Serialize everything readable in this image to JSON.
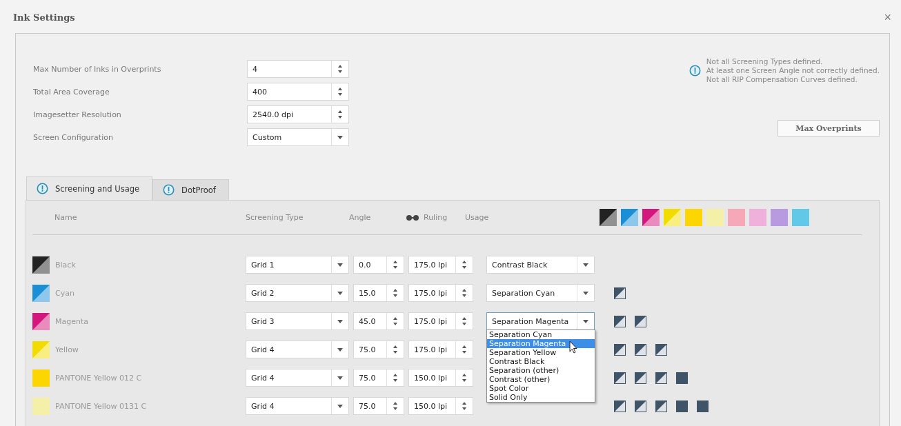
{
  "window": {
    "title": "Ink Settings",
    "close": "×"
  },
  "settings": [
    {
      "label": "Max Number of Inks in Overprints",
      "kind": "spin",
      "value": "4"
    },
    {
      "label": "Total Area Coverage",
      "kind": "spin",
      "value": "400"
    },
    {
      "label": "Imagesetter Resolution",
      "kind": "spin",
      "value": "2540.0 dpi"
    },
    {
      "label": "Screen Configuration",
      "kind": "select",
      "value": "Custom"
    }
  ],
  "warnings": [
    "Not all Screening Types defined.",
    "At least one Screen Angle not correctly defined.",
    "Not all RIP Compensation Curves defined."
  ],
  "max_overprints_button": "Max Overprints",
  "tabs": [
    {
      "label": "Screening and Usage",
      "selected": true,
      "warning": true
    },
    {
      "label": "DotProof",
      "selected": false,
      "warning": true
    }
  ],
  "columns": {
    "name": "Name",
    "screening_type": "Screening Type",
    "angle": "Angle",
    "ruling": "Ruling",
    "usage": "Usage"
  },
  "header_swatches": [
    {
      "kind": "split",
      "color": "#222222"
    },
    {
      "kind": "split",
      "color": "#1b8fd6"
    },
    {
      "kind": "split",
      "color": "#d4177c"
    },
    {
      "kind": "split",
      "color": "#f2dc00"
    },
    {
      "kind": "solid",
      "color": "#fdd500"
    },
    {
      "kind": "solid",
      "color": "#f5f0a8"
    },
    {
      "kind": "solid",
      "color": "#f7a8b8"
    },
    {
      "kind": "solid",
      "color": "#f0b0dc"
    },
    {
      "kind": "solid",
      "color": "#b89ae0"
    },
    {
      "kind": "solid",
      "color": "#62c8e8"
    }
  ],
  "inks": [
    {
      "name": "Black",
      "swatch": {
        "kind": "split",
        "color": "#222222"
      },
      "screening_type": "Grid 1",
      "angle": "0.0",
      "ruling": "175.0 lpi",
      "usage": "Contrast Black",
      "usage_open": false
    },
    {
      "name": "Cyan",
      "swatch": {
        "kind": "split",
        "color": "#1b8fd6"
      },
      "screening_type": "Grid 2",
      "angle": "15.0",
      "ruling": "175.0 lpi",
      "usage": "Separation Cyan",
      "usage_open": false,
      "overprints": [
        {
          "kind": "split"
        }
      ]
    },
    {
      "name": "Magenta",
      "swatch": {
        "kind": "split",
        "color": "#d4177c"
      },
      "screening_type": "Grid 3",
      "angle": "45.0",
      "ruling": "175.0 lpi",
      "usage": "Separation Magenta",
      "usage_open": true,
      "overprints": [
        {
          "kind": "split"
        },
        {
          "kind": "split"
        }
      ]
    },
    {
      "name": "Yellow",
      "swatch": {
        "kind": "split",
        "color": "#f2dc00"
      },
      "screening_type": "Grid 4",
      "angle": "75.0",
      "ruling": "175.0 lpi",
      "overprints": [
        {
          "kind": "split"
        },
        {
          "kind": "split"
        },
        {
          "kind": "split"
        }
      ]
    },
    {
      "name": "PANTONE Yellow 012 C",
      "swatch": {
        "kind": "solid",
        "color": "#fdd500"
      },
      "screening_type": "Grid 4",
      "angle": "75.0",
      "ruling": "150.0 lpi",
      "overprints": [
        {
          "kind": "split"
        },
        {
          "kind": "split"
        },
        {
          "kind": "split"
        },
        {
          "kind": "solid"
        }
      ]
    },
    {
      "name": "PANTONE Yellow 0131 C",
      "swatch": {
        "kind": "solid",
        "color": "#f5f0a8"
      },
      "screening_type": "Grid 4",
      "angle": "75.0",
      "ruling": "150.0 lpi",
      "overprints": [
        {
          "kind": "split"
        },
        {
          "kind": "split"
        },
        {
          "kind": "split"
        },
        {
          "kind": "solid"
        },
        {
          "kind": "solid"
        }
      ]
    }
  ],
  "usage_menu": [
    {
      "label": "Separation Cyan",
      "selected": false
    },
    {
      "label": "Separation Magenta",
      "selected": true
    },
    {
      "label": "Separation Yellow",
      "selected": false
    },
    {
      "label": "Contrast Black",
      "selected": false
    },
    {
      "label": "Separation (other)",
      "selected": false
    },
    {
      "label": "Contrast (other)",
      "selected": false
    },
    {
      "label": "Spot Color",
      "selected": false
    },
    {
      "label": "Solid Only",
      "selected": false
    }
  ]
}
